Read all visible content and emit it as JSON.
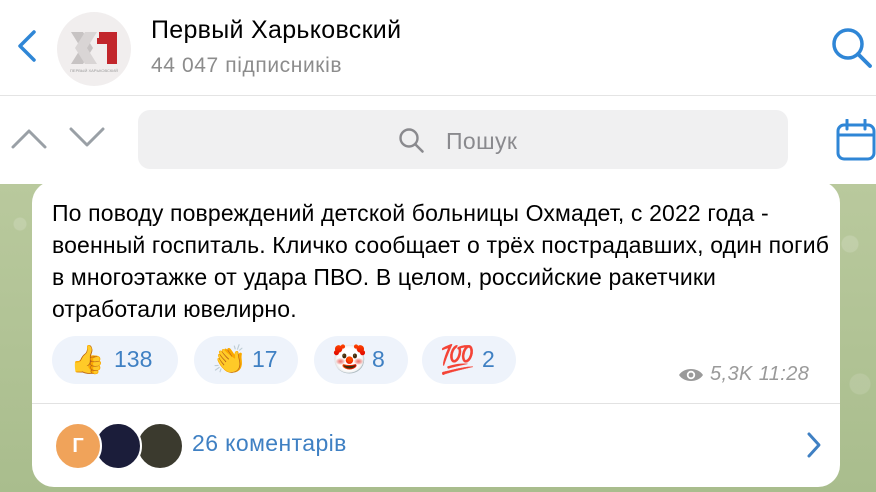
{
  "header": {
    "channel_title": "Первый Харьковский",
    "subscribers": "44 047 підписників",
    "logo_text": "ПЕРВЫЙ ХАРЬКОВСКИЙ"
  },
  "search": {
    "placeholder": "Пошук"
  },
  "message": {
    "text": "По поводу повреждений детской больницы Охмадет, с 2022 года - военный госпиталь. Кличко сообщает о трёх пострадавших, один погиб в многоэтажке от удара ПВО. В целом, российские ракетчики отработали ювелирно.",
    "views": "5,3K",
    "time": "11:28",
    "reactions": [
      {
        "emoji": "👍",
        "count": "138"
      },
      {
        "emoji": "👏",
        "count": "17"
      },
      {
        "emoji": "🤡",
        "count": "8"
      },
      {
        "emoji": "💯",
        "count": "2"
      }
    ],
    "comments_label": "26 коментарів",
    "commenter_initial": "Г"
  },
  "colors": {
    "accent": "#3f80c3",
    "icon_blue": "#2f86d6",
    "reaction_bg": "#eef3fb",
    "chat_bg": "#b7c79b",
    "logo_red": "#c2262c"
  },
  "icons": [
    "back-chevron-icon",
    "search-icon",
    "up-arrow-icon",
    "down-arrow-icon",
    "calendar-icon",
    "eye-icon",
    "chevron-right-icon"
  ]
}
